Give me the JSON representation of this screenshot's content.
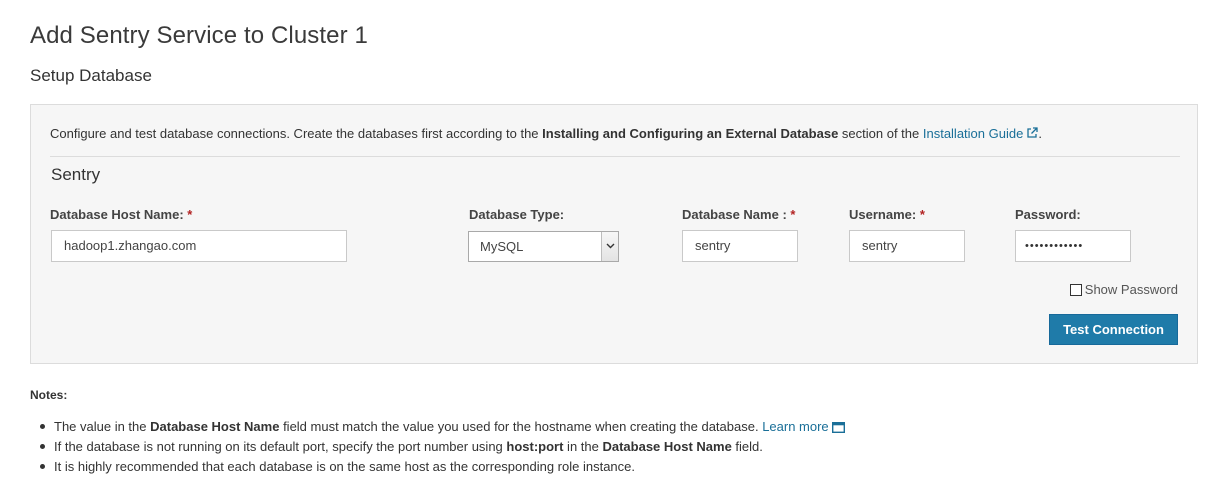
{
  "header": {
    "title": "Add Sentry Service to Cluster 1",
    "subtitle": "Setup Database"
  },
  "panel": {
    "intro_prefix": "Configure and test database connections. Create the databases first according to the ",
    "intro_bold": "Installing and Configuring an External Database",
    "intro_mid": " section of the ",
    "intro_link": "Installation Guide",
    "intro_suffix": ".",
    "db_heading": "Sentry",
    "fields": {
      "host_label": "Database Host Name:",
      "host_value": "hadoop1.zhangao.com",
      "type_label": "Database Type:",
      "type_value": "MySQL",
      "name_label": "Database Name :",
      "name_value": "sentry",
      "user_label": "Username:",
      "user_value": "sentry",
      "password_label": "Password:",
      "password_value": "••••••••••••",
      "required_mark": "*"
    },
    "show_password_label": "Show Password",
    "test_button": "Test Connection"
  },
  "notes": {
    "title": "Notes:",
    "item1_prefix": "The value in the ",
    "item1_bold": "Database Host Name",
    "item1_suffix": " field must match the value you used for the hostname when creating the database. ",
    "item1_link": "Learn more",
    "item2_prefix": "If the database is not running on its default port, specify the port number using ",
    "item2_bold1": "host:port",
    "item2_mid": " in the ",
    "item2_bold2": "Database Host Name",
    "item2_suffix": " field.",
    "item3": "It is highly recommended that each database is on the same host as the corresponding role instance."
  },
  "colors": {
    "accent": "#1f7ba9",
    "link": "#1a6f98",
    "required": "#b22222",
    "panel_bg": "#f6f6f6"
  },
  "icons": {
    "external_link": "external-link-icon",
    "popup_window": "window-icon",
    "dropdown": "chevron-down-icon"
  }
}
